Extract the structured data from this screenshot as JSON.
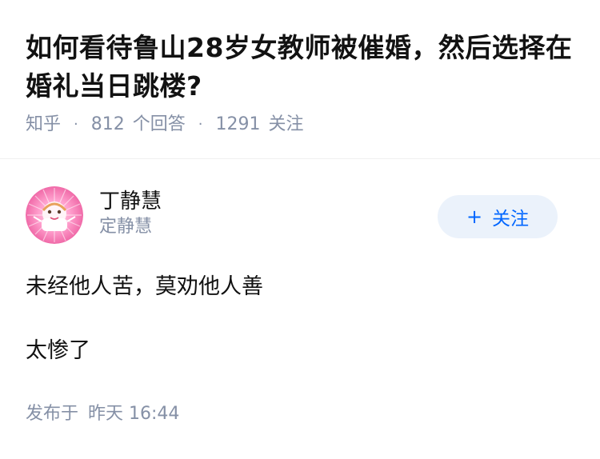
{
  "question": {
    "title": "如何看待鲁山28岁女教师被催婚，然后选择在婚礼当日跳楼?",
    "source": "知乎",
    "answer_count": "812",
    "answer_label": "个回答",
    "follower_count": "1291",
    "follower_label": "关注",
    "separator": "·"
  },
  "answer": {
    "author": {
      "name": "丁静慧",
      "headline": "定静慧",
      "avatar_icon": "avatar-icon"
    },
    "follow_button": {
      "plus": "+",
      "label": "关注"
    },
    "paragraphs": [
      "未经他人苦，莫劝他人善",
      "太惨了"
    ],
    "published": {
      "label": "发布于",
      "time": "昨天 16:44"
    }
  },
  "colors": {
    "text_primary": "#121212",
    "text_secondary": "#8590a6",
    "accent": "#0066ff",
    "button_bg": "#ebf2fb"
  }
}
